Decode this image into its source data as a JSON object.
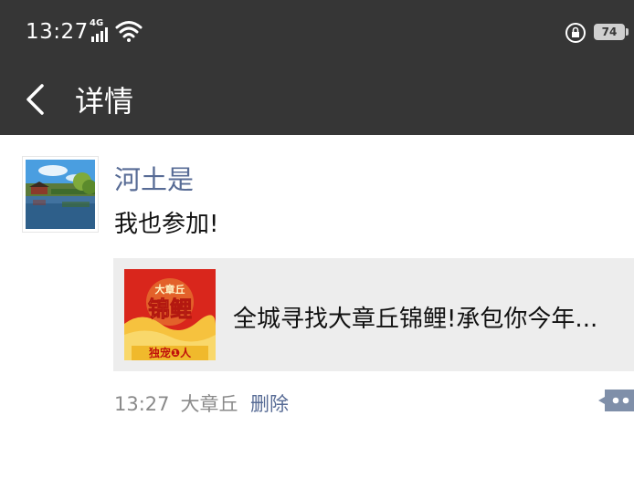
{
  "status_bar": {
    "time": "13:27",
    "network": "4G",
    "battery": "74"
  },
  "header": {
    "back_icon": "back-chevron-icon",
    "title": "详情"
  },
  "post": {
    "username": "河土是",
    "text": "我也参加!",
    "shared_link": {
      "title": "全城寻找大章丘锦鲤!承包你今年...",
      "thumbnail_text_top": "大章丘",
      "thumbnail_text_main": "锦鲤",
      "thumbnail_text_bottom": "独宠❶人"
    },
    "time": "13:27",
    "location": "大章丘",
    "delete_label": "删除"
  },
  "colors": {
    "header_bg": "#363636",
    "link_blue": "#576b95",
    "card_bg": "#ededed"
  }
}
